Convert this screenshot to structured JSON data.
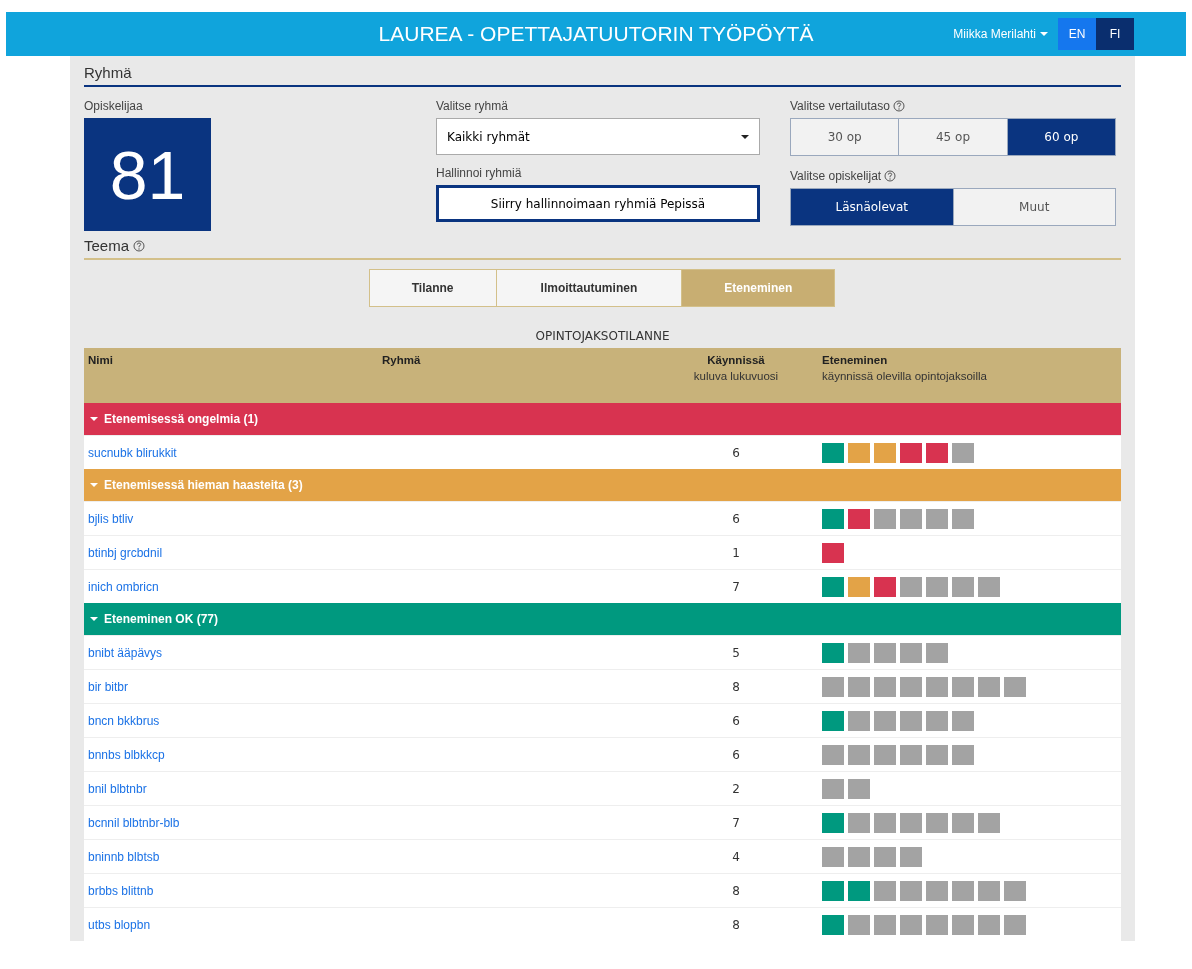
{
  "header": {
    "title": "LAUREA - OPETTAJATUUTORIN TYÖPÖYTÄ",
    "user": "Miikka Merilahti",
    "languages": [
      {
        "label": "EN",
        "selected": false
      },
      {
        "label": "FI",
        "selected": true
      }
    ]
  },
  "group_section": {
    "title": "Ryhmä",
    "students_label": "Opiskelijaa",
    "students_count": "81",
    "group_select": {
      "label": "Valitse ryhmä",
      "value": "Kaikki ryhmät"
    },
    "manage": {
      "label": "Hallinnoi ryhmiä",
      "button": "Siirry hallinnoimaan ryhmiä Pepissä"
    },
    "level": {
      "label": "Valitse vertailutaso",
      "options": [
        {
          "label": "30 op",
          "selected": false
        },
        {
          "label": "45 op",
          "selected": false
        },
        {
          "label": "60 op",
          "selected": true
        }
      ]
    },
    "students": {
      "label": "Valitse opiskelijat",
      "options": [
        {
          "label": "Läsnäolevat",
          "selected": true
        },
        {
          "label": "Muut",
          "selected": false
        }
      ]
    }
  },
  "theme_section": {
    "title": "Teema",
    "tabs": [
      {
        "label": "Tilanne",
        "selected": false
      },
      {
        "label": "Ilmoittautuminen",
        "selected": false
      },
      {
        "label": "Eteneminen",
        "selected": true
      }
    ]
  },
  "table": {
    "title": "OPINTOJAKSOTILANNE",
    "columns": [
      {
        "label": "Nimi"
      },
      {
        "label": "Ryhmä"
      },
      {
        "label": "Käynnissä",
        "sub": "kuluva lukuvuosi"
      },
      {
        "label": "Eteneminen",
        "sub": "käynnissä olevilla opintojaksoilla"
      }
    ],
    "groups": [
      {
        "title": "Etenemisessä ongelmia (1)",
        "color": "#d83350",
        "expanded": true,
        "rows": [
          {
            "name": "sucnubk blirukkit",
            "count": "6",
            "progress": [
              {
                "color": "#00997f"
              },
              {
                "color": "#e3a347"
              },
              {
                "color": "#e3a347"
              },
              {
                "color": "#d83350"
              },
              {
                "color": "#d83350"
              },
              {
                "color": "#a3a3a3"
              }
            ]
          }
        ]
      },
      {
        "title": "Etenemisessä hieman haasteita (3)",
        "color": "#e3a347",
        "expanded": true,
        "rows": [
          {
            "name": "bjlis btliv",
            "count": "6",
            "progress": [
              {
                "color": "#00997f"
              },
              {
                "color": "#d83350"
              },
              {
                "color": "#a3a3a3"
              },
              {
                "color": "#a3a3a3"
              },
              {
                "color": "#a3a3a3"
              },
              {
                "color": "#a3a3a3"
              }
            ]
          },
          {
            "name": "btinbj grcbdnil",
            "count": "1",
            "progress": [
              {
                "color": "#d83350"
              }
            ]
          },
          {
            "name": "inich ombricn",
            "count": "7",
            "progress": [
              {
                "color": "#00997f"
              },
              {
                "color": "#e3a347"
              },
              {
                "color": "#d83350"
              },
              {
                "color": "#a3a3a3"
              },
              {
                "color": "#a3a3a3"
              },
              {
                "color": "#a3a3a3"
              },
              {
                "color": "#a3a3a3"
              }
            ]
          }
        ]
      },
      {
        "title": "Eteneminen OK (77)",
        "color": "#00997f",
        "expanded": true,
        "rows": [
          {
            "name": "bnibt ääpävys",
            "count": "5",
            "progress": [
              {
                "color": "#00997f"
              },
              {
                "color": "#a3a3a3"
              },
              {
                "color": "#a3a3a3"
              },
              {
                "color": "#a3a3a3"
              },
              {
                "color": "#a3a3a3"
              }
            ]
          },
          {
            "name": "bir bitbr",
            "count": "8",
            "progress": [
              {
                "color": "#a3a3a3"
              },
              {
                "color": "#a3a3a3"
              },
              {
                "color": "#a3a3a3"
              },
              {
                "color": "#a3a3a3"
              },
              {
                "color": "#a3a3a3"
              },
              {
                "color": "#a3a3a3"
              },
              {
                "color": "#a3a3a3"
              },
              {
                "color": "#a3a3a3"
              }
            ]
          },
          {
            "name": "bncn bkkbrus",
            "count": "6",
            "progress": [
              {
                "color": "#00997f"
              },
              {
                "color": "#a3a3a3"
              },
              {
                "color": "#a3a3a3"
              },
              {
                "color": "#a3a3a3"
              },
              {
                "color": "#a3a3a3"
              },
              {
                "color": "#a3a3a3"
              }
            ]
          },
          {
            "name": "bnnbs blbkkcp",
            "count": "6",
            "progress": [
              {
                "color": "#a3a3a3"
              },
              {
                "color": "#a3a3a3"
              },
              {
                "color": "#a3a3a3"
              },
              {
                "color": "#a3a3a3"
              },
              {
                "color": "#a3a3a3"
              },
              {
                "color": "#a3a3a3"
              }
            ]
          },
          {
            "name": "bnil blbtnbr",
            "count": "2",
            "progress": [
              {
                "color": "#a3a3a3"
              },
              {
                "color": "#a3a3a3"
              }
            ]
          },
          {
            "name": "bcnnil blbtnbr-blb",
            "count": "7",
            "progress": [
              {
                "color": "#00997f"
              },
              {
                "color": "#a3a3a3"
              },
              {
                "color": "#a3a3a3"
              },
              {
                "color": "#a3a3a3"
              },
              {
                "color": "#a3a3a3"
              },
              {
                "color": "#a3a3a3"
              },
              {
                "color": "#a3a3a3"
              }
            ]
          },
          {
            "name": "bninnb blbtsb",
            "count": "4",
            "progress": [
              {
                "color": "#a3a3a3"
              },
              {
                "color": "#a3a3a3"
              },
              {
                "color": "#a3a3a3"
              },
              {
                "color": "#a3a3a3"
              }
            ]
          },
          {
            "name": "brbbs blittnb",
            "count": "8",
            "progress": [
              {
                "color": "#00997f"
              },
              {
                "color": "#00997f"
              },
              {
                "color": "#a3a3a3"
              },
              {
                "color": "#a3a3a3"
              },
              {
                "color": "#a3a3a3"
              },
              {
                "color": "#a3a3a3"
              },
              {
                "color": "#a3a3a3"
              },
              {
                "color": "#a3a3a3"
              }
            ]
          },
          {
            "name": "utbs blopbn",
            "count": "8",
            "progress": [
              {
                "color": "#00997f"
              },
              {
                "color": "#a3a3a3"
              },
              {
                "color": "#a3a3a3"
              },
              {
                "color": "#a3a3a3"
              },
              {
                "color": "#a3a3a3"
              },
              {
                "color": "#a3a3a3"
              },
              {
                "color": "#a3a3a3"
              },
              {
                "color": "#a3a3a3"
              }
            ]
          }
        ]
      }
    ]
  }
}
